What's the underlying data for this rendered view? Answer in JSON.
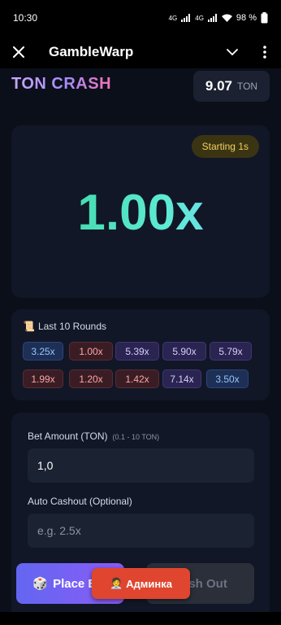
{
  "status_bar": {
    "time": "10:30",
    "signal1": "4G",
    "signal2": "4G",
    "battery": "98 %"
  },
  "app_bar": {
    "title": "GambleWarp",
    "close_icon": "close-icon",
    "collapse_icon": "chevron-down-icon",
    "menu_icon": "more-vert-icon"
  },
  "header": {
    "game_title": "TON CRASH",
    "balance_amount": "9.07",
    "balance_currency": "TON"
  },
  "crash": {
    "status_badge": "Starting 1s",
    "multiplier": "1.00x"
  },
  "rounds": {
    "title_icon": "📜",
    "title": "Last 10 Rounds",
    "row1": [
      {
        "value": "3.25x",
        "tier": "blue"
      },
      {
        "value": "1.00x",
        "tier": "red"
      },
      {
        "value": "5.39x",
        "tier": "purple"
      },
      {
        "value": "5.90x",
        "tier": "purple"
      },
      {
        "value": "5.79x",
        "tier": "purple"
      }
    ],
    "row2": [
      {
        "value": "1.99x",
        "tier": "red"
      },
      {
        "value": "1.20x",
        "tier": "red"
      },
      {
        "value": "1.42x",
        "tier": "red"
      },
      {
        "value": "7.14x",
        "tier": "purple"
      },
      {
        "value": "3.50x",
        "tier": "blue"
      }
    ]
  },
  "bet": {
    "amount_label": "Bet Amount (TON)",
    "amount_range": "(0.1 - 10 TON)",
    "amount_value": "1,0",
    "autocashout_label": "Auto Cashout (Optional)",
    "autocashout_placeholder": "e.g. 2.5x",
    "place_icon": "🎲",
    "place_label": "Place Bet",
    "cashout_label": "Cash Out"
  },
  "admin_button": {
    "icon": "🧑‍💼",
    "label": "Админка"
  },
  "colors": {
    "accent": "#8b5cf6",
    "multiplier": "#34d399",
    "badge_text": "#f3d25a",
    "admin": "#e0452f"
  }
}
